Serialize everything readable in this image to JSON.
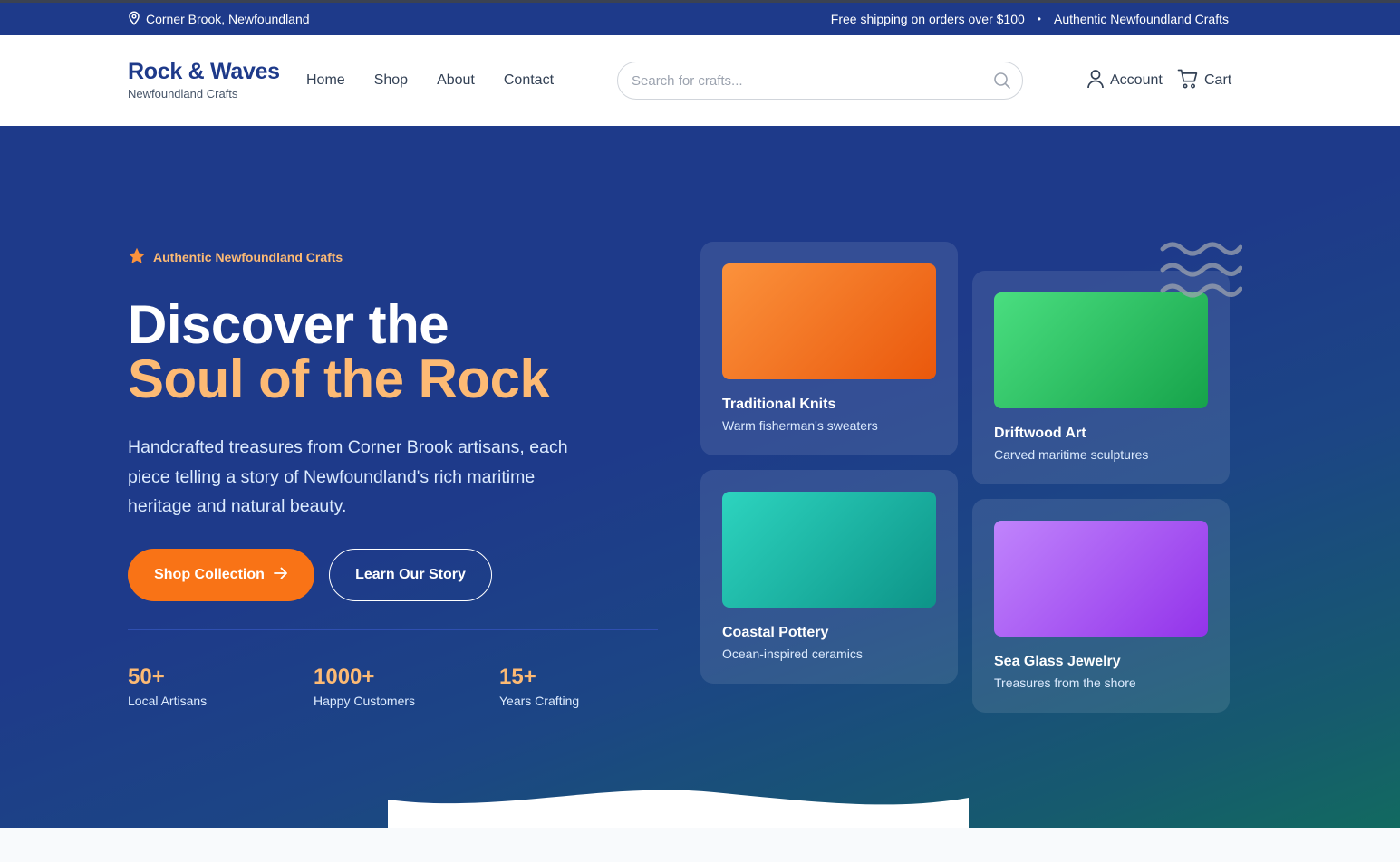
{
  "topbar": {
    "location": "Corner Brook, Newfoundland",
    "shipping": "Free shipping on orders over $100",
    "separator": "•",
    "tagline": "Authentic Newfoundland Crafts"
  },
  "header": {
    "logo_name": "Rock & Waves",
    "logo_sub": "Newfoundland Crafts",
    "nav": [
      "Home",
      "Shop",
      "About",
      "Contact"
    ],
    "search_placeholder": "Search for crafts...",
    "account_label": "Account",
    "cart_label": "Cart"
  },
  "hero": {
    "badge": "Authentic Newfoundland Crafts",
    "title_line1": "Discover the",
    "title_line2": "Soul of the Rock",
    "description": "Handcrafted treasures from Corner Brook artisans, each piece telling a story of Newfoundland's rich maritime heritage and natural beauty.",
    "primary_button": "Shop Collection",
    "secondary_button": "Learn Our Story",
    "stats": [
      {
        "value": "50+",
        "label": "Local Artisans"
      },
      {
        "value": "1000+",
        "label": "Happy Customers"
      },
      {
        "value": "15+",
        "label": "Years Crafting"
      }
    ],
    "cards": [
      {
        "title": "Traditional Knits",
        "subtitle": "Warm fisherman's sweaters",
        "color_from": "#fb923c",
        "color_to": "#ea580c"
      },
      {
        "title": "Driftwood Art",
        "subtitle": "Carved maritime sculptures",
        "color_from": "#4ade80",
        "color_to": "#16a34a"
      },
      {
        "title": "Coastal Pottery",
        "subtitle": "Ocean-inspired ceramics",
        "color_from": "#2dd4bf",
        "color_to": "#0d9488"
      },
      {
        "title": "Sea Glass Jewelry",
        "subtitle": "Treasures from the shore",
        "color_from": "#c084fc",
        "color_to": "#9333ea"
      }
    ]
  },
  "colors": {
    "primary": "#1e3a8a",
    "accent": "#f97316",
    "accent_light": "#fdba74"
  }
}
